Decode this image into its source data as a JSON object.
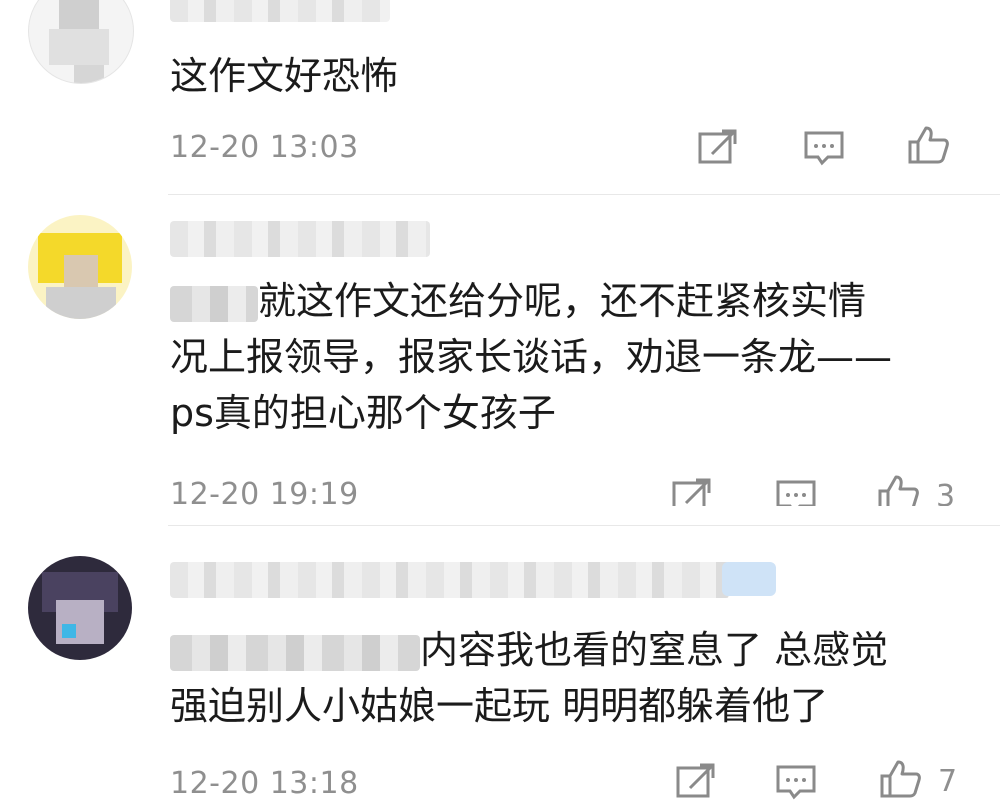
{
  "comments": [
    {
      "text_lines": [
        "这作文好恐怖"
      ],
      "time": "12-20 13:03",
      "like_count": ""
    },
    {
      "text_lines": [
        "就这作文还给分呢，还不赶紧核实情",
        "况上报领导，报家长谈话，劝退一条龙——",
        "ps真的担心那个女孩子"
      ],
      "time": "12-20 19:19",
      "like_count": "3"
    },
    {
      "text_lines": [
        "内容我也看的窒息了 总感觉",
        "强迫别人小姑娘一起玩 明明都躲着他了"
      ],
      "time": "12-20 13:18",
      "like_count": "7"
    }
  ],
  "icons": {
    "share": "share-icon",
    "reply": "comment-icon",
    "like": "thumbs-up-icon"
  },
  "colors": {
    "text": "#1b1b1b",
    "meta": "#8f8f8f",
    "divider": "#e8e8e8"
  }
}
